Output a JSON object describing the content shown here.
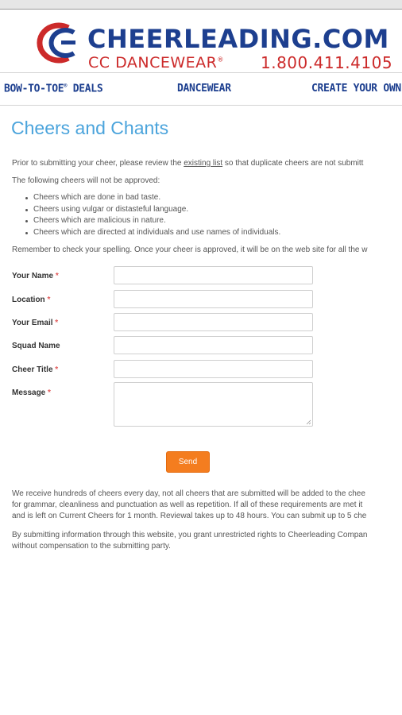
{
  "brand": {
    "name": "CHEERLEADING.COM",
    "sub": "CC DANCEWEAR",
    "sub_mark": "®",
    "phone": "1.800.411.4105",
    "colors": {
      "blue": "#1d3f8f",
      "red": "#cc2a2a",
      "accent": "#4ba4dc",
      "button": "#f47d1f"
    }
  },
  "nav": {
    "items": [
      {
        "label": "BOW-TO-TOE",
        "mark": "®",
        "suffix": " DEALS"
      },
      {
        "label": "DANCEWEAR"
      },
      {
        "label": "CREATE YOUR OWN"
      }
    ]
  },
  "page": {
    "title": "Cheers and Chants",
    "intro_before": "Prior to submitting your cheer, please review the ",
    "intro_link": "existing list",
    "intro_after": " so that duplicate cheers are not submitt",
    "not_approved": "The following cheers will not be approved:",
    "rules": [
      "Cheers which are done in bad taste.",
      "Cheers using vulgar or distasteful language.",
      "Cheers which are malicious in nature.",
      "Cheers which are directed at individuals and use names of individuals."
    ],
    "remember": "Remember to check your spelling. Once your cheer is approved, it will be on the web site for all the w"
  },
  "form": {
    "required_mark": "*",
    "fields": [
      {
        "label": "Your Name",
        "required": true,
        "value": ""
      },
      {
        "label": "Location",
        "required": true,
        "value": ""
      },
      {
        "label": "Your Email",
        "required": true,
        "value": ""
      },
      {
        "label": "Squad Name",
        "required": false,
        "value": ""
      },
      {
        "label": "Cheer Title",
        "required": true,
        "value": ""
      },
      {
        "label": "Message",
        "required": true,
        "value": ""
      }
    ],
    "submit_label": "Send"
  },
  "footer": {
    "para1": [
      "We receive hundreds of cheers every day, not all cheers that are submitted will be added to the chee",
      "for grammar, cleanliness and punctuation as well as repetition. If all of these requirements are met it",
      "and is left on Current Cheers for 1 month. Reviewal takes up to 48 hours. You can submit up to 5 che"
    ],
    "para2": [
      "By submitting information through this website, you grant unrestricted rights to Cheerleading Compan",
      "without compensation to the submitting party."
    ]
  }
}
